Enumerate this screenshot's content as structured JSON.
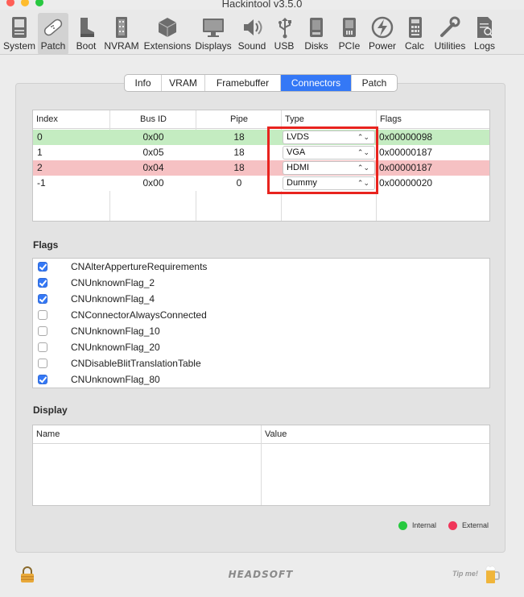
{
  "window": {
    "title": "Hackintool v3.5.0"
  },
  "toolbar": [
    {
      "label": "System",
      "icon": "system-icon"
    },
    {
      "label": "Patch",
      "icon": "patch-icon",
      "selected": true
    },
    {
      "label": "Boot",
      "icon": "boot-icon"
    },
    {
      "label": "NVRAM",
      "icon": "nvram-icon"
    },
    {
      "label": "Extensions",
      "icon": "extensions-icon"
    },
    {
      "label": "Displays",
      "icon": "displays-icon"
    },
    {
      "label": "Sound",
      "icon": "sound-icon"
    },
    {
      "label": "USB",
      "icon": "usb-icon"
    },
    {
      "label": "Disks",
      "icon": "disks-icon"
    },
    {
      "label": "PCIe",
      "icon": "pcie-icon"
    },
    {
      "label": "Power",
      "icon": "power-icon"
    },
    {
      "label": "Calc",
      "icon": "calc-icon"
    },
    {
      "label": "Utilities",
      "icon": "utilities-icon"
    },
    {
      "label": "Logs",
      "icon": "logs-icon"
    }
  ],
  "tabs": [
    {
      "label": "Info"
    },
    {
      "label": "VRAM"
    },
    {
      "label": "Framebuffer"
    },
    {
      "label": "Connectors",
      "active": true
    },
    {
      "label": "Patch"
    }
  ],
  "connectors": {
    "columns": [
      "Index",
      "Bus ID",
      "Pipe",
      "Type",
      "Flags"
    ],
    "rows": [
      {
        "index": "0",
        "bus_id": "0x00",
        "pipe": "18",
        "type": "LVDS",
        "flags": "0x00000098",
        "status": "internal"
      },
      {
        "index": "1",
        "bus_id": "0x05",
        "pipe": "18",
        "type": "VGA",
        "flags": "0x00000187",
        "status": "none"
      },
      {
        "index": "2",
        "bus_id": "0x04",
        "pipe": "18",
        "type": "HDMI",
        "flags": "0x00000187",
        "status": "external"
      },
      {
        "index": "-1",
        "bus_id": "0x00",
        "pipe": "0",
        "type": "Dummy",
        "flags": "0x00000020",
        "status": "none"
      }
    ]
  },
  "flags_section": {
    "title": "Flags",
    "items": [
      {
        "label": "CNAlterAppertureRequirements",
        "checked": true
      },
      {
        "label": "CNUnknownFlag_2",
        "checked": true
      },
      {
        "label": "CNUnknownFlag_4",
        "checked": true
      },
      {
        "label": "CNConnectorAlwaysConnected",
        "checked": false
      },
      {
        "label": "CNUnknownFlag_10",
        "checked": false
      },
      {
        "label": "CNUnknownFlag_20",
        "checked": false
      },
      {
        "label": "CNDisableBlitTranslationTable",
        "checked": false
      },
      {
        "label": "CNUnknownFlag_80",
        "checked": true
      }
    ]
  },
  "display_section": {
    "title": "Display",
    "columns": [
      "Name",
      "Value"
    ]
  },
  "legend": {
    "internal": "Internal",
    "external": "External"
  },
  "footer": {
    "logo": "HEADSOFT",
    "tip": "Tip me!"
  },
  "colors": {
    "accent": "#3478f6",
    "internal_row": "#c4ecc1",
    "external_row": "#f6c1c3",
    "internal_dot": "#27c93f",
    "external_dot": "#f0365a",
    "highlight": "#e8231e"
  }
}
